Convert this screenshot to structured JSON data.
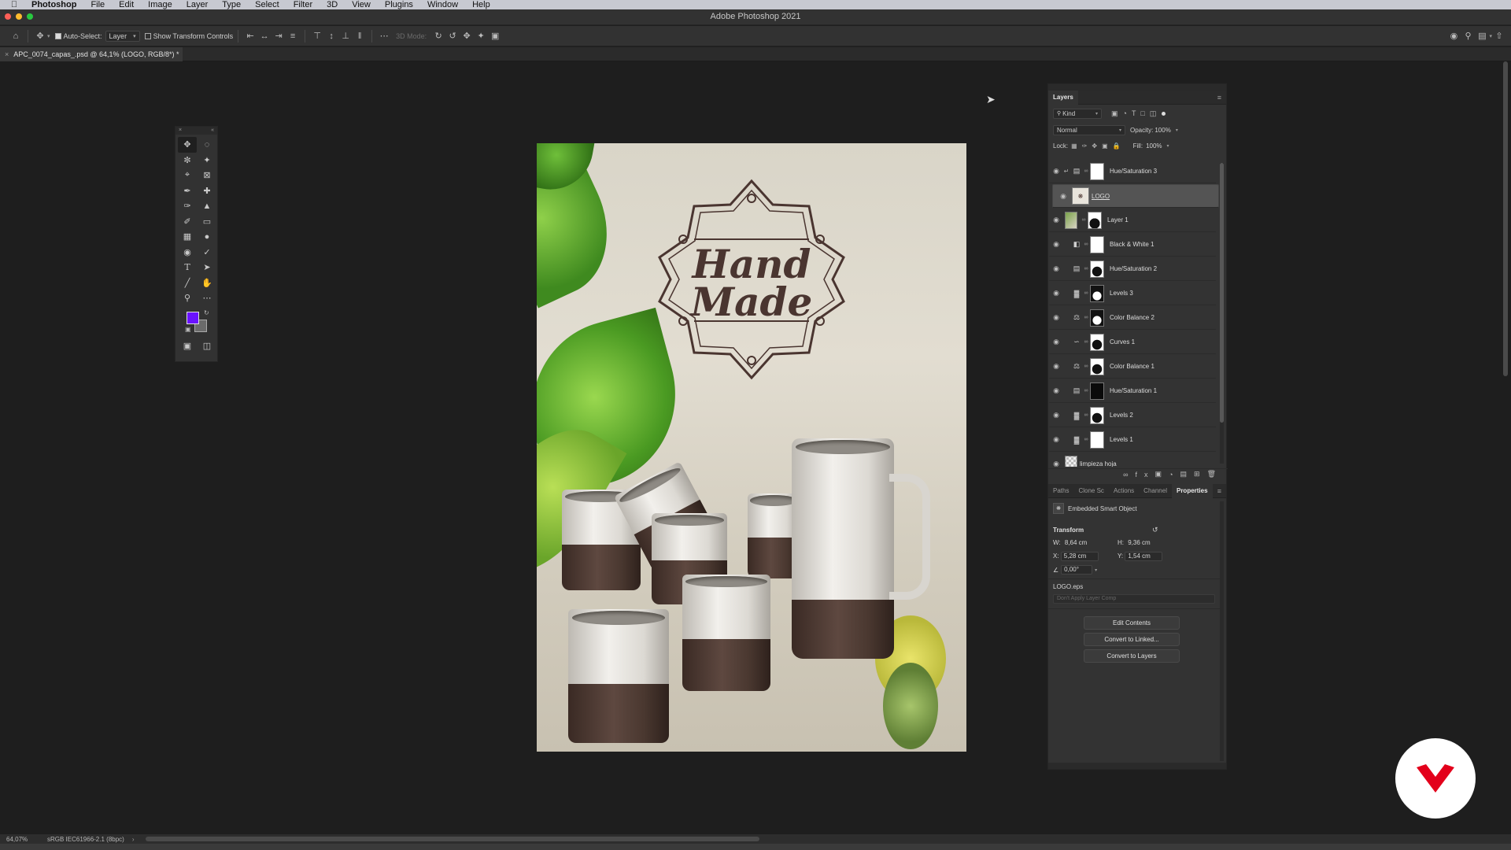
{
  "menubar": {
    "apple_icon": "apple-logo-icon",
    "items": [
      "Photoshop",
      "File",
      "Edit",
      "Image",
      "Layer",
      "Type",
      "Select",
      "Filter",
      "3D",
      "View",
      "Plugins",
      "Window",
      "Help"
    ]
  },
  "window": {
    "title": "Adobe Photoshop 2021",
    "traffic_colors": [
      "#ff5f57",
      "#febc2e",
      "#28c840"
    ]
  },
  "options": {
    "auto_select_label": "Auto-Select:",
    "auto_select_target": "Layer",
    "show_transform_label": "Show Transform Controls",
    "mode_3d_label": "3D Mode:"
  },
  "document": {
    "tab_title": "APC_0074_capas_.psd @ 64,1% (LOGO, RGB/8*) *"
  },
  "tools": {
    "foreground_color": "#6a12ff",
    "background_color": "#6b6b6b"
  },
  "canvas": {
    "logo_line1": "Hand",
    "logo_line2": "Made"
  },
  "layers_panel": {
    "title": "Layers",
    "filter_kind": "Kind",
    "blend_mode": "Normal",
    "opacity_label": "Opacity:",
    "opacity_value": "100%",
    "lock_label": "Lock:",
    "fill_label": "Fill:",
    "fill_value": "100%",
    "layers": [
      {
        "name": "Hue/Saturation 3",
        "type": "hue",
        "mask": "white",
        "clipped": true
      },
      {
        "name": "LOGO",
        "type": "smart",
        "mask": "none",
        "selected": true
      },
      {
        "name": "Layer 1",
        "type": "photo",
        "mask": "silhouette"
      },
      {
        "name": "Black & White 1",
        "type": "bw",
        "mask": "white"
      },
      {
        "name": "Hue/Saturation 2",
        "type": "hue",
        "mask": "silhouette"
      },
      {
        "name": "Levels 3",
        "type": "levels",
        "mask": "silhouette"
      },
      {
        "name": "Color Balance 2",
        "type": "balance",
        "mask": "silhouette"
      },
      {
        "name": "Curves 1",
        "type": "curves",
        "mask": "silhouette"
      },
      {
        "name": "Color Balance 1",
        "type": "balance",
        "mask": "silhouette"
      },
      {
        "name": "Hue/Saturation 1",
        "type": "hue",
        "mask": "black"
      },
      {
        "name": "Levels 2",
        "type": "levels",
        "mask": "silhouette"
      },
      {
        "name": "Levels 1",
        "type": "levels",
        "mask": "white"
      },
      {
        "name": "limpieza hoja",
        "type": "pixel",
        "mask": "none"
      }
    ]
  },
  "lower_panel": {
    "tabs": [
      "Paths",
      "Clone Sc",
      "Actions",
      "Channel",
      "Properties"
    ],
    "active_tab": "Properties",
    "object_type": "Embedded Smart Object",
    "transform_label": "Transform",
    "w_label": "W:",
    "w_value": "8,64 cm",
    "h_label": "H:",
    "h_value": "9,36 cm",
    "x_label": "X:",
    "x_value": "5,28 cm",
    "y_label": "Y:",
    "y_value": "1,54 cm",
    "angle_value": "0,00°",
    "file_name": "LOGO.eps",
    "layer_comp_placeholder": "Don't Apply Layer Comp",
    "buttons": [
      "Edit Contents",
      "Convert to Linked...",
      "Convert to Layers"
    ]
  },
  "status": {
    "zoom": "64,07%",
    "profile": "sRGB IEC61966-2.1 (8bpc)"
  },
  "watermark": {
    "color": "#e3001b"
  }
}
